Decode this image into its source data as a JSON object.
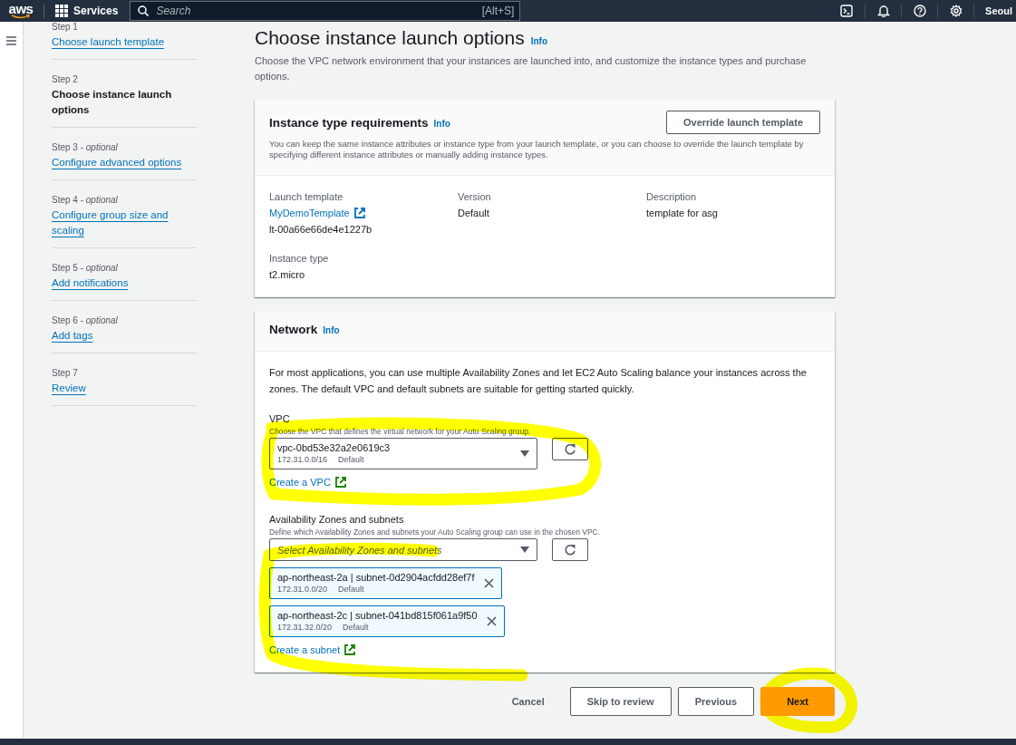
{
  "top_nav": {
    "logo": "aws",
    "services": "Services",
    "search": {
      "placeholder": "Search",
      "shortcut": "[Alt+S]"
    },
    "region": "Seoul"
  },
  "steps": [
    {
      "label": "Step 1",
      "title": "Choose launch template",
      "selected": false
    },
    {
      "label": "Step 2",
      "title": "Choose instance launch options",
      "selected": true
    },
    {
      "label": "Step 3 - *optional*",
      "title": "Configure advanced options",
      "selected": false
    },
    {
      "label": "Step 4 - *optional*",
      "title": "Configure group size and scaling",
      "selected": false
    },
    {
      "label": "Step 5 - *optional*",
      "title": "Add notifications",
      "selected": false
    },
    {
      "label": "Step 6 - *optional*",
      "title": "Add tags",
      "selected": false
    },
    {
      "label": "Step 7",
      "title": "Review",
      "selected": false
    }
  ],
  "page": {
    "title": "Choose instance launch options",
    "info": "Info",
    "description": "Choose the VPC network environment that your instances are launched into, and customize the instance types and purchase options."
  },
  "instance_card": {
    "title": "Instance type requirements",
    "info": "Info",
    "button": "Override launch template",
    "description": "You can keep the same instance attributes or instance type from your launch template, or you can choose to override the launch template by specifying different instance attributes or manually adding instance types.",
    "fields": [
      {
        "label": "Launch template",
        "link": "MyDemoTemplate",
        "value": "lt-00a66e66de4e1227b"
      },
      {
        "label": "Version",
        "value": "Default"
      },
      {
        "label": "Description",
        "value": "template for asg"
      },
      {
        "label": "Instance type",
        "value": "t2.micro"
      }
    ]
  },
  "network_card": {
    "title": "Network",
    "info": "Info",
    "description": "For most applications, you can use multiple Availability Zones and let EC2 Auto Scaling balance your instances across the zones. The default VPC and default subnets are suitable for getting started quickly.",
    "vpc": {
      "label": "VPC",
      "hint": "Choose the VPC that defines the virtual network for your Auto Scaling group.",
      "value": "vpc-0bd53e32a2e0619c3",
      "cidr": "172.31.0.0/16",
      "tag": "Default",
      "link": "Create a VPC"
    },
    "subnets": {
      "label": "Availability Zones and subnets",
      "hint": "Define which Availability Zones and subnets your Auto Scaling group can use in the chosen VPC.",
      "placeholder": "Select Availability Zones and subnets",
      "link": "Create a subnet",
      "tokens": [
        {
          "name": "ap-northeast-2a | subnet-0d2904acfdd28ef7f",
          "cidr": "172.31.0.0/20",
          "tag": "Default"
        },
        {
          "name": "ap-northeast-2c | subnet-041bd815f061a9f50",
          "cidr": "172.31.32.0/20",
          "tag": "Default"
        }
      ]
    }
  },
  "footer_buttons": [
    {
      "label": "Cancel",
      "kind": "link"
    },
    {
      "label": "Skip to review",
      "kind": "normal"
    },
    {
      "label": "Previous",
      "kind": "normal"
    },
    {
      "label": "Next",
      "kind": "primary"
    }
  ]
}
